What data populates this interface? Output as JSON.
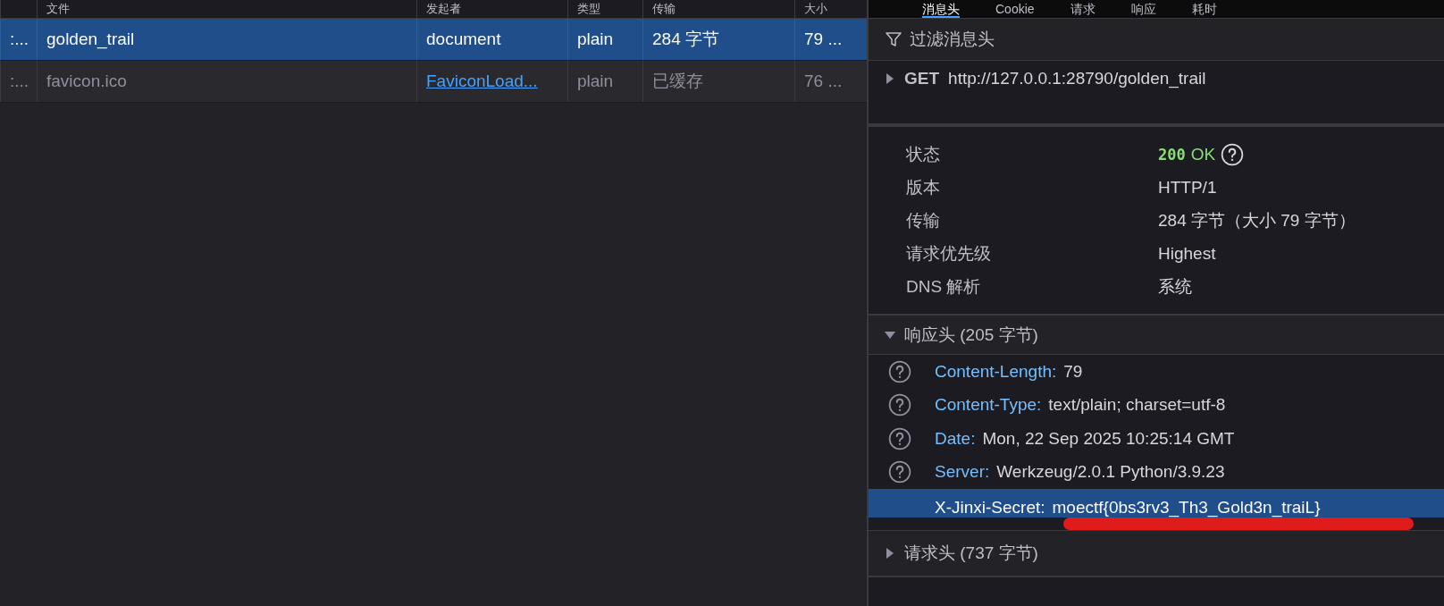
{
  "requests": {
    "columns": [
      "文件",
      "发起者",
      "类型",
      "传输",
      "大小"
    ],
    "rows": [
      {
        "column_1": ":...",
        "file": "golden_trail",
        "initiator": {
          "text": "document",
          "link": false
        },
        "type": "plain",
        "transfer": "284 字节",
        "size": "79 ...",
        "selected": true,
        "cached": false
      },
      {
        "column_1": ":...",
        "file": "favicon.ico",
        "initiator": {
          "text": "FaviconLoad...",
          "link": true
        },
        "type": "plain",
        "transfer": "已缓存",
        "size": "76 ...",
        "selected": false,
        "cached": true
      }
    ]
  },
  "details": {
    "tabs": [
      {
        "label": "消息头",
        "selected": true
      },
      {
        "label": "Cookie",
        "selected": false
      },
      {
        "label": "请求",
        "selected": false
      },
      {
        "label": "响应",
        "selected": false
      },
      {
        "label": "耗时",
        "selected": false
      }
    ],
    "filter": {
      "placeholder": "过滤消息头"
    },
    "request_line": {
      "method": "GET",
      "url": "http://127.0.0.1:28790/golden_trail",
      "expanded": false
    },
    "summary": [
      {
        "kind": "status",
        "label": "状态",
        "code": "200",
        "value": "OK"
      },
      {
        "kind": "text",
        "label": "版本",
        "value": "HTTP/1"
      },
      {
        "kind": "text",
        "label": "传输",
        "value": "284 字节（大小 79 字节）"
      },
      {
        "kind": "text",
        "label": "请求优先级",
        "value": "Highest"
      },
      {
        "kind": "text",
        "label": "DNS 解析",
        "value": "系统"
      }
    ],
    "response_headers": {
      "title": "响应头 (205 字节)",
      "expanded": true,
      "headers": [
        {
          "name": "Content-Length:",
          "value": "79",
          "help_icon": true,
          "selected": false,
          "marked": false
        },
        {
          "name": "Content-Type:",
          "value": "text/plain; charset=utf-8",
          "help_icon": true,
          "selected": false,
          "marked": false
        },
        {
          "name": "Date:",
          "value": "Mon, 22 Sep 2025 10:25:14 GMT",
          "help_icon": true,
          "selected": false,
          "marked": false
        },
        {
          "name": "Server:",
          "value": "Werkzeug/2.0.1 Python/3.9.23",
          "help_icon": true,
          "selected": false,
          "marked": false
        },
        {
          "name": "X-Jinxi-Secret:",
          "value": "moectf{0bs3rv3_Th3_Gold3n_traiL}",
          "help_icon": false,
          "selected": true,
          "marked": true
        }
      ]
    },
    "request_headers": {
      "title": "请求头 (737 字节)",
      "expanded": false
    }
  }
}
